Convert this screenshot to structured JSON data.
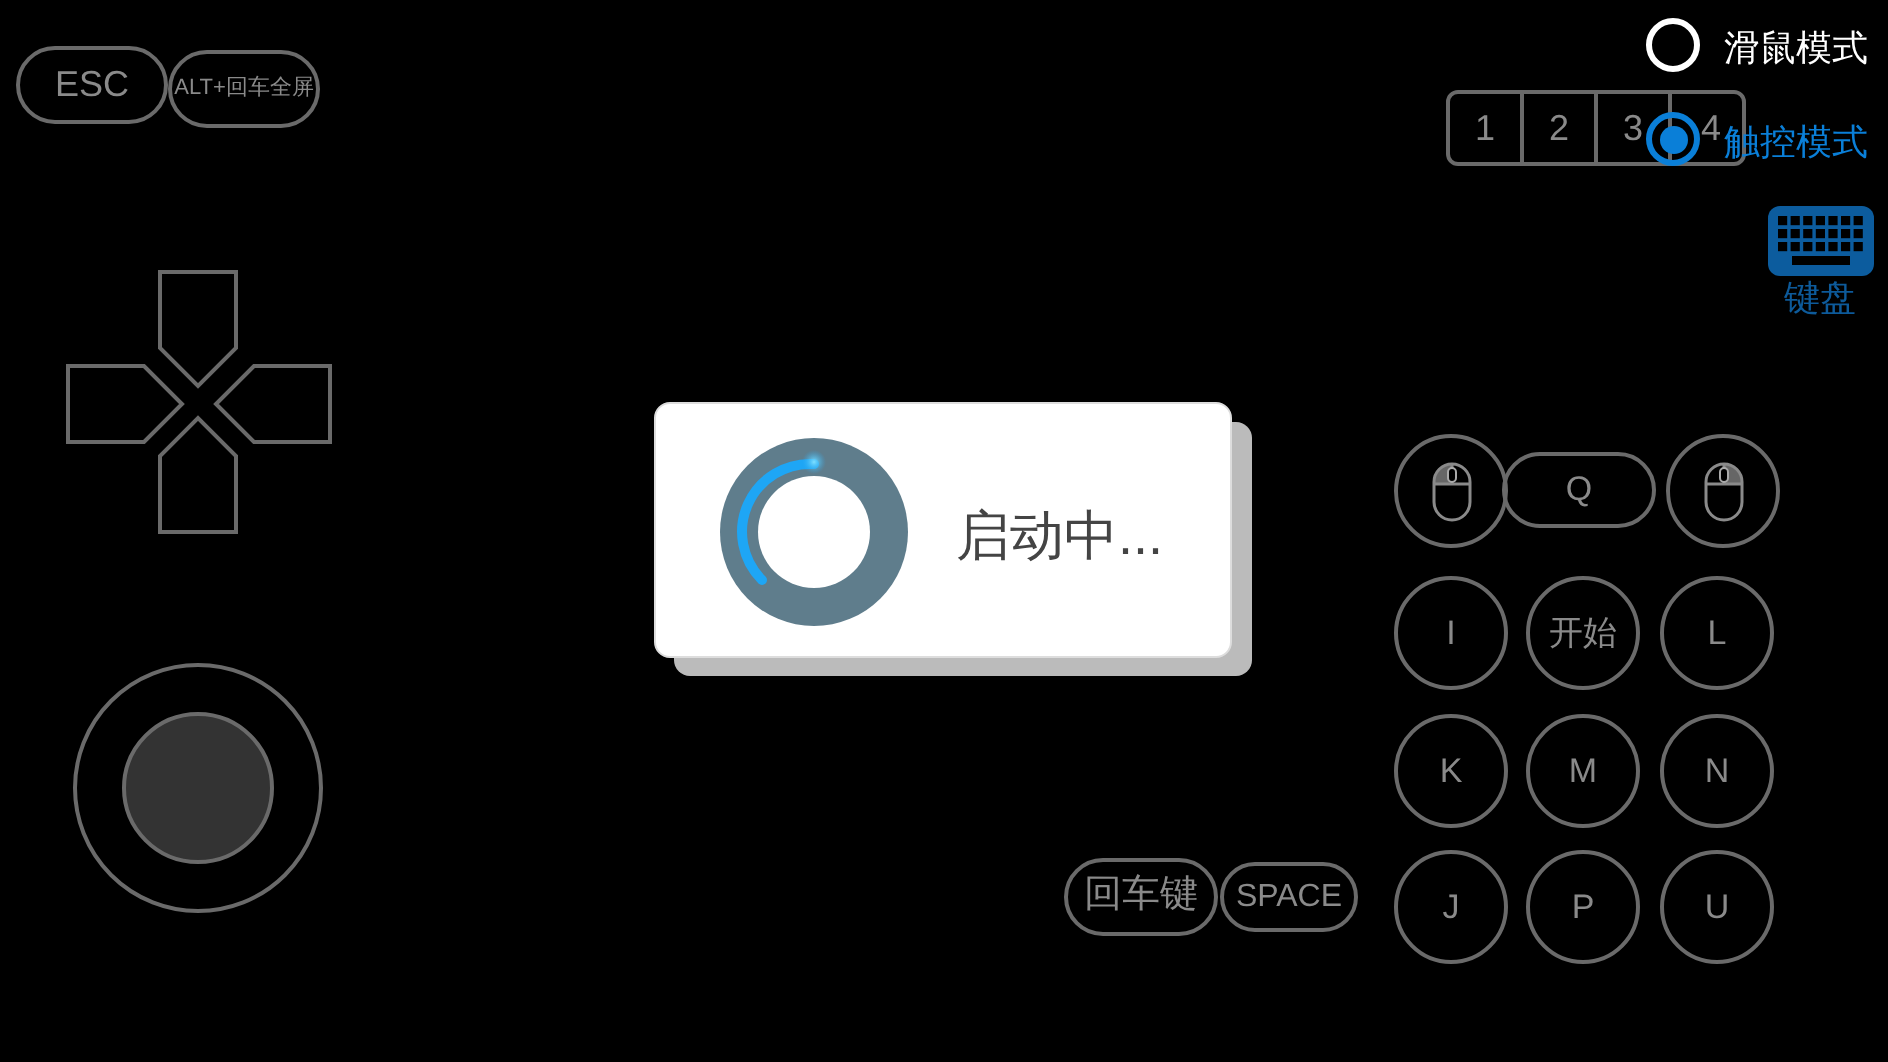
{
  "top_buttons": [
    {
      "label": "ESC"
    },
    {
      "label": "ALT+回车全屏"
    }
  ],
  "modes": [
    {
      "label": "滑鼠模式",
      "selected": false
    },
    {
      "label": "触控模式",
      "selected": true
    }
  ],
  "slots": [
    {
      "label": "1"
    },
    {
      "label": "2"
    },
    {
      "label": "3"
    },
    {
      "label": "4"
    }
  ],
  "keyboard": {
    "label": "键盘"
  },
  "dialog": {
    "message": "启动中..."
  },
  "keys": [
    {
      "kind": "mouse-left"
    },
    {
      "kind": "pill",
      "label": "Q"
    },
    {
      "kind": "mouse-right"
    },
    {
      "kind": "round",
      "label": "I"
    },
    {
      "kind": "round",
      "label": "开始"
    },
    {
      "kind": "round",
      "label": "L"
    },
    {
      "kind": "round",
      "label": "K"
    },
    {
      "kind": "round",
      "label": "M"
    },
    {
      "kind": "round",
      "label": "N"
    },
    {
      "kind": "round",
      "label": "J"
    },
    {
      "kind": "round",
      "label": "P"
    },
    {
      "kind": "round",
      "label": "U"
    }
  ],
  "bottom_buttons": [
    {
      "label": "回车键"
    },
    {
      "label": "SPACE"
    }
  ]
}
